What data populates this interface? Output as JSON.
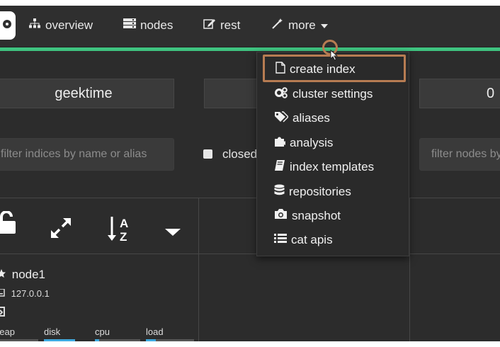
{
  "nav": {
    "overview": "overview",
    "nodes": "nodes",
    "rest": "rest",
    "more": "more"
  },
  "cluster": {
    "name": "geektime",
    "count": "0"
  },
  "filters": {
    "indices_placeholder": "filter indices by name or alias",
    "nodes_placeholder": "filter nodes by name",
    "closed_label": "closed"
  },
  "node": {
    "name": "node1",
    "ip": "127.0.0.1",
    "metrics": [
      {
        "label": "heap",
        "fill": 0.0
      },
      {
        "label": "disk",
        "fill": 1.0
      },
      {
        "label": "cpu",
        "fill": 0.1
      },
      {
        "label": "load",
        "fill": 0.2
      }
    ]
  },
  "more_menu": {
    "items": [
      {
        "label": "create index",
        "icon": "file-icon"
      },
      {
        "label": "cluster settings",
        "icon": "cogs-icon"
      },
      {
        "label": "aliases",
        "icon": "tags-icon"
      },
      {
        "label": "analysis",
        "icon": "puzzle-icon"
      },
      {
        "label": "index templates",
        "icon": "book-icon"
      },
      {
        "label": "repositories",
        "icon": "database-icon"
      },
      {
        "label": "snapshot",
        "icon": "camera-icon"
      },
      {
        "label": "cat apis",
        "icon": "list-icon"
      }
    ]
  },
  "colors": {
    "accent": "#3fc380",
    "highlight": "#b77c52",
    "metric_fill": "#3ea9e0"
  }
}
